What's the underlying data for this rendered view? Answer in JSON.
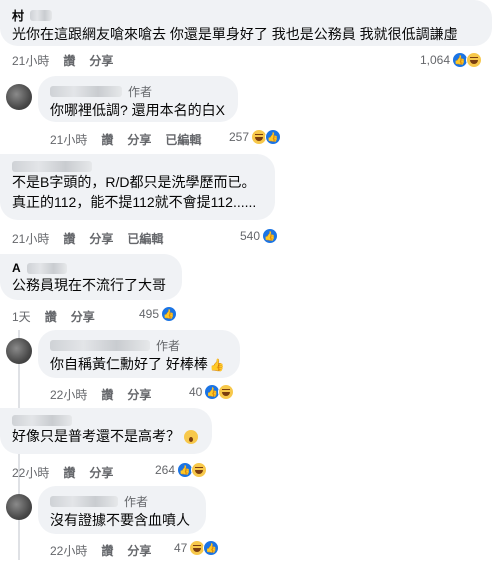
{
  "comments": [
    {
      "name": "村",
      "is_author": false,
      "text": "光你在這跟網友嗆來嗆去 你還是單身好了 我也是公務員 我就很低調謙虛",
      "time": "21小時",
      "reply": "讚",
      "share": "分享",
      "edited": "",
      "count": "1,064",
      "reactions": [
        "like-icon",
        "haha-icon"
      ]
    },
    {
      "name": "",
      "is_author": true,
      "text": "你哪裡低調? 還用本名的白X",
      "time": "21小時",
      "reply": "讚",
      "share": "分享",
      "edited": "已編輯",
      "count": "257",
      "reactions": [
        "haha-icon",
        "like-icon"
      ]
    },
    {
      "name": "",
      "is_author": false,
      "text_lines": [
        "不是B字頭的，R/D都只是洗學歷而已。",
        "真正的112，能不提112就不會提112......"
      ],
      "time": "21小時",
      "reply": "讚",
      "share": "分享",
      "edited": "已編輯",
      "count": "540",
      "reactions": [
        "like-icon"
      ]
    },
    {
      "name": "A",
      "is_author": false,
      "text": "公務員現在不流行了大哥",
      "time": "1天",
      "reply": "讚",
      "share": "分享",
      "edited": "",
      "count": "495",
      "reactions": [
        "like-icon"
      ]
    },
    {
      "name": "",
      "is_author": true,
      "text": "你自稱黃仁勳好了 好棒棒",
      "time": "22小時",
      "reply": "讚",
      "share": "分享",
      "edited": "",
      "count": "40",
      "reactions": [
        "like-icon",
        "haha-icon"
      ]
    },
    {
      "name": "",
      "is_author": false,
      "text": "好像只是普考還不是高考？",
      "time": "22小時",
      "reply": "讚",
      "share": "分享",
      "edited": "",
      "count": "264",
      "reactions": [
        "like-icon",
        "haha-icon"
      ]
    },
    {
      "name": "",
      "is_author": true,
      "text": "沒有證據不要含血噴人",
      "time": "22小時",
      "reply": "讚",
      "share": "分享",
      "edited": "",
      "count": "47",
      "reactions": [
        "haha-icon",
        "like-icon"
      ]
    }
  ],
  "author_label": "作者",
  "colors": {
    "like": "#1b74e4",
    "bubble": "#f0f2f5",
    "meta": "#65676b"
  }
}
